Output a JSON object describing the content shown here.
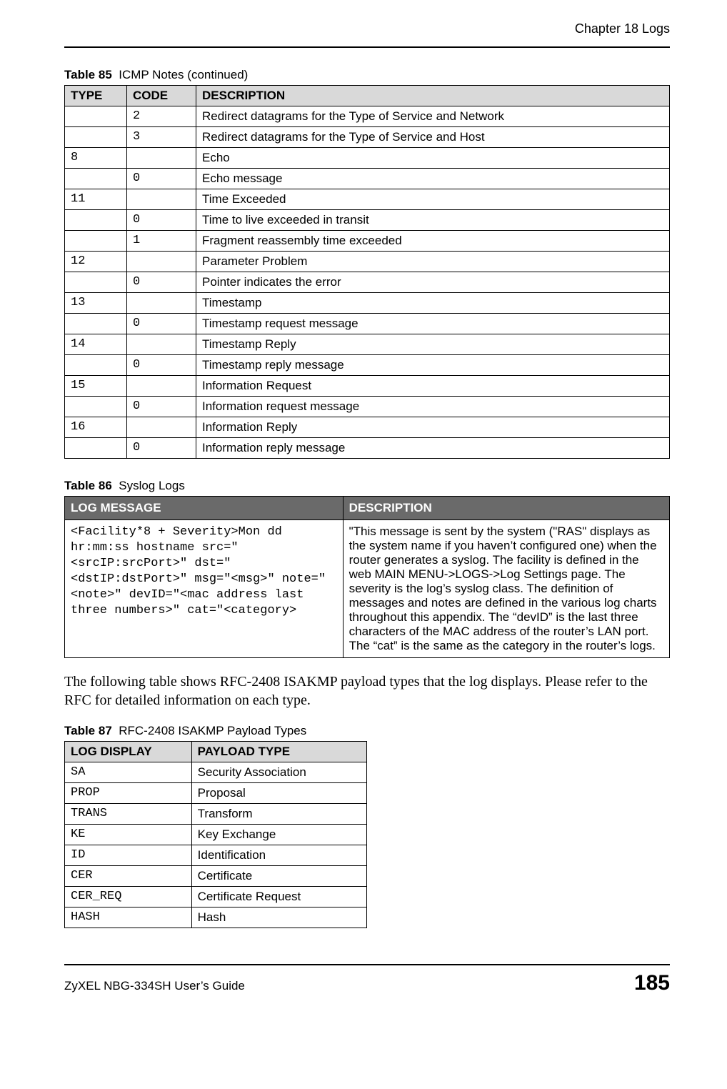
{
  "header": {
    "chapter": "Chapter 18 Logs"
  },
  "table85": {
    "caption_num": "Table 85",
    "caption_title": "ICMP Notes (continued)",
    "headers": {
      "type": "TYPE",
      "code": "CODE",
      "desc": "DESCRIPTION"
    },
    "rows": [
      {
        "type": "",
        "code": "2",
        "desc": "Redirect datagrams for the Type of Service and Network"
      },
      {
        "type": "",
        "code": "3",
        "desc": "Redirect datagrams for the Type of Service and Host"
      },
      {
        "type": "8",
        "code": "",
        "desc": "Echo"
      },
      {
        "type": "",
        "code": "0",
        "desc": "Echo message"
      },
      {
        "type": "11",
        "code": "",
        "desc": "Time Exceeded"
      },
      {
        "type": "",
        "code": "0",
        "desc": "Time to live exceeded in transit"
      },
      {
        "type": "",
        "code": "1",
        "desc": "Fragment reassembly time exceeded"
      },
      {
        "type": "12",
        "code": "",
        "desc": "Parameter Problem"
      },
      {
        "type": "",
        "code": "0",
        "desc": "Pointer indicates the error"
      },
      {
        "type": "13",
        "code": "",
        "desc": "Timestamp"
      },
      {
        "type": "",
        "code": "0",
        "desc": "Timestamp request message"
      },
      {
        "type": "14",
        "code": "",
        "desc": "Timestamp Reply"
      },
      {
        "type": "",
        "code": "0",
        "desc": "Timestamp reply message"
      },
      {
        "type": "15",
        "code": "",
        "desc": "Information Request"
      },
      {
        "type": "",
        "code": "0",
        "desc": "Information request message"
      },
      {
        "type": "16",
        "code": "",
        "desc": "Information Reply"
      },
      {
        "type": "",
        "code": "0",
        "desc": "Information reply message"
      }
    ]
  },
  "table86": {
    "caption_num": "Table 86",
    "caption_title": "Syslog Logs",
    "headers": {
      "log": "LOG MESSAGE",
      "desc": "DESCRIPTION"
    },
    "row": {
      "log": "<Facility*8 + Severity>Mon dd hr:mm:ss hostname src=\"<srcIP:srcPort>\" dst=\"<dstIP:dstPort>\" msg=\"<msg>\" note=\"<note>\" devID=\"<mac address last three numbers>\" cat=\"<category>",
      "desc": "\"This message is sent by the system (\"RAS\" displays as the system name if you haven’t configured one) when the router generates a syslog. The facility is defined in the web MAIN MENU->LOGS->Log Settings page. The severity is the log’s syslog class. The definition of messages and notes are defined in the various log charts throughout this appendix. The “devID” is the last three characters of the MAC address of the router’s LAN port. The “cat” is the same as the category in the router’s logs."
    }
  },
  "body_para": "The following table shows RFC-2408 ISAKMP payload types that the log displays. Please refer to the RFC for detailed information on each type.",
  "table87": {
    "caption_num": "Table 87",
    "caption_title": "RFC-2408 ISAKMP Payload Types",
    "headers": {
      "disp": "LOG DISPLAY",
      "ptype": "PAYLOAD TYPE"
    },
    "rows": [
      {
        "disp": "SA",
        "ptype": "Security Association"
      },
      {
        "disp": "PROP",
        "ptype": "Proposal"
      },
      {
        "disp": "TRANS",
        "ptype": "Transform"
      },
      {
        "disp": "KE",
        "ptype": "Key Exchange"
      },
      {
        "disp": "ID",
        "ptype": "Identification"
      },
      {
        "disp": "CER",
        "ptype": "Certificate"
      },
      {
        "disp": "CER_REQ",
        "ptype": "Certificate Request"
      },
      {
        "disp": "HASH",
        "ptype": "Hash"
      }
    ]
  },
  "footer": {
    "left": "ZyXEL NBG-334SH User’s Guide",
    "right": "185"
  }
}
